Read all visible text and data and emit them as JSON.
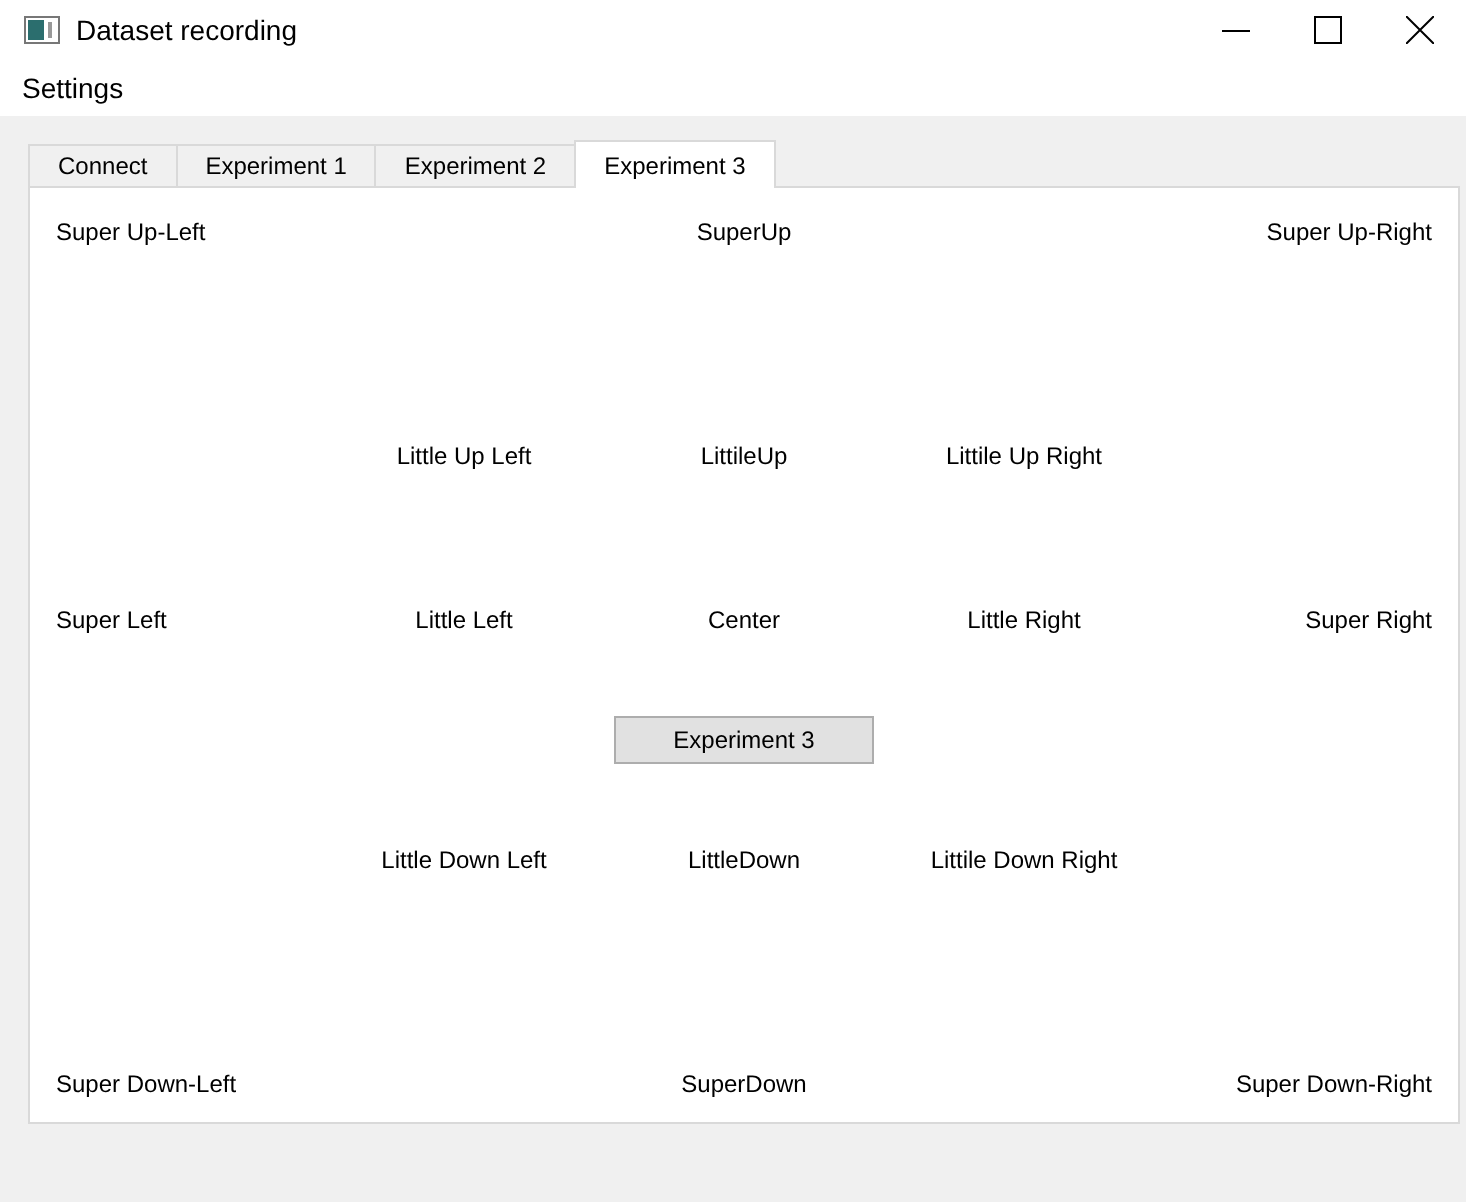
{
  "window": {
    "title": "Dataset recording"
  },
  "menu": [
    "Settings"
  ],
  "tabs": [
    {
      "label": "Connect",
      "selected": false
    },
    {
      "label": "Experiment 1",
      "selected": false
    },
    {
      "label": "Experiment 2",
      "selected": false
    },
    {
      "label": "Experiment 3",
      "selected": true
    }
  ],
  "rows": [
    {
      "kind": "super",
      "labels": [
        "Super Up-Left",
        "SuperUp",
        "Super Up-Right"
      ]
    },
    {
      "kind": "little",
      "labels": [
        "Little Up Left",
        "LittileUp",
        "Littile Up Right"
      ]
    },
    {
      "kind": "super",
      "labels": [
        "Super Left",
        "Little Left",
        "Center",
        "Little Right",
        "Super Right"
      ]
    },
    {
      "kind": "button",
      "labels": [
        "Experiment 3"
      ]
    },
    {
      "kind": "little",
      "labels": [
        "Little Down Left",
        "LittleDown",
        "Littile Down Right"
      ]
    },
    {
      "kind": "super",
      "labels": [
        "Super Down-Left",
        "SuperDown",
        "Super Down-Right"
      ]
    }
  ]
}
